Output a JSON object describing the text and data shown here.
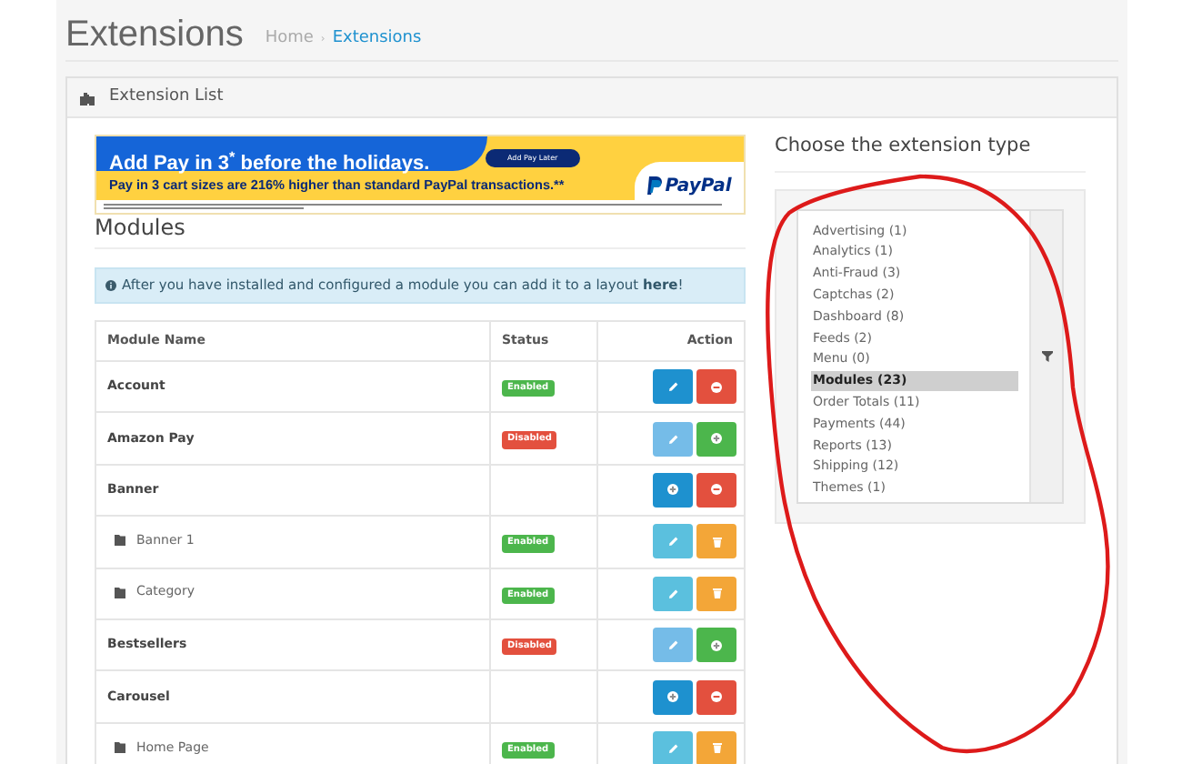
{
  "page_title": "Extensions",
  "breadcrumb": [
    {
      "label": "Home",
      "selected": false
    },
    {
      "label": "Extensions",
      "selected": true
    }
  ],
  "breadcrumb_separator": "›",
  "panel": {
    "title": "Extension List"
  },
  "banner": {
    "headline": "Add Pay in 3",
    "headline_mark": "*",
    "headline_rest": "before the holidays.",
    "button": "Add Pay Later",
    "subline": "Pay in 3 cart sizes are 216% higher than standard PayPal transactions.**",
    "logo": "PayPal"
  },
  "section_title": "Modules",
  "alert": {
    "text": "After you have installed and configured a module you can add it to a layout **here**!"
  },
  "table": {
    "columns": [
      "Module Name",
      "Status",
      "Action"
    ],
    "rows": [
      {
        "kind": "module",
        "name": "Account",
        "status": {
          "label": "Enabled",
          "enabled": true
        },
        "actions": [
          {
            "kind": "edit",
            "disabled": false
          },
          {
            "kind": "uninstall"
          }
        ]
      },
      {
        "kind": "module",
        "name": "Amazon Pay",
        "status": {
          "label": "Disabled",
          "enabled": false
        },
        "actions": [
          {
            "kind": "edit",
            "disabled": true
          },
          {
            "kind": "install"
          }
        ]
      },
      {
        "kind": "module",
        "name": "Banner",
        "actions": [
          {
            "kind": "add"
          },
          {
            "kind": "uninstall"
          }
        ]
      },
      {
        "kind": "child",
        "name": "Banner 1",
        "status": {
          "label": "Enabled",
          "enabled": true
        },
        "actions": [
          {
            "kind": "edit_child"
          },
          {
            "kind": "delete"
          }
        ]
      },
      {
        "kind": "child",
        "name": "Category",
        "status": {
          "label": "Enabled",
          "enabled": true
        },
        "actions": [
          {
            "kind": "edit_child"
          },
          {
            "kind": "delete"
          }
        ]
      },
      {
        "kind": "module",
        "name": "Bestsellers",
        "status": {
          "label": "Disabled",
          "enabled": false
        },
        "actions": [
          {
            "kind": "edit",
            "disabled": true
          },
          {
            "kind": "install"
          }
        ]
      },
      {
        "kind": "module",
        "name": "Carousel",
        "actions": [
          {
            "kind": "add"
          },
          {
            "kind": "uninstall"
          }
        ]
      },
      {
        "kind": "child",
        "name": "Home Page",
        "status": {
          "label": "Enabled",
          "enabled": true
        },
        "actions": [
          {
            "kind": "edit_child"
          },
          {
            "kind": "delete"
          }
        ]
      }
    ]
  },
  "type_chooser": {
    "title": "Choose the extension type",
    "options": [
      {
        "label": "Advertising (1)",
        "selected": false
      },
      {
        "label": "Analytics (1)",
        "selected": false
      },
      {
        "label": "Anti-Fraud (3)",
        "selected": false
      },
      {
        "label": "Captchas (2)",
        "selected": false
      },
      {
        "label": "Dashboard (8)",
        "selected": false
      },
      {
        "label": "Feeds (2)",
        "selected": false
      },
      {
        "label": "Menu (0)",
        "selected": false
      },
      {
        "label": "Modules (23)",
        "selected": true
      },
      {
        "label": "Order Totals (11)",
        "selected": false
      },
      {
        "label": "Payments (44)",
        "selected": false
      },
      {
        "label": "Reports (13)",
        "selected": false
      },
      {
        "label": "Shipping (12)",
        "selected": false
      },
      {
        "label": "Themes (1)",
        "selected": false
      }
    ]
  }
}
